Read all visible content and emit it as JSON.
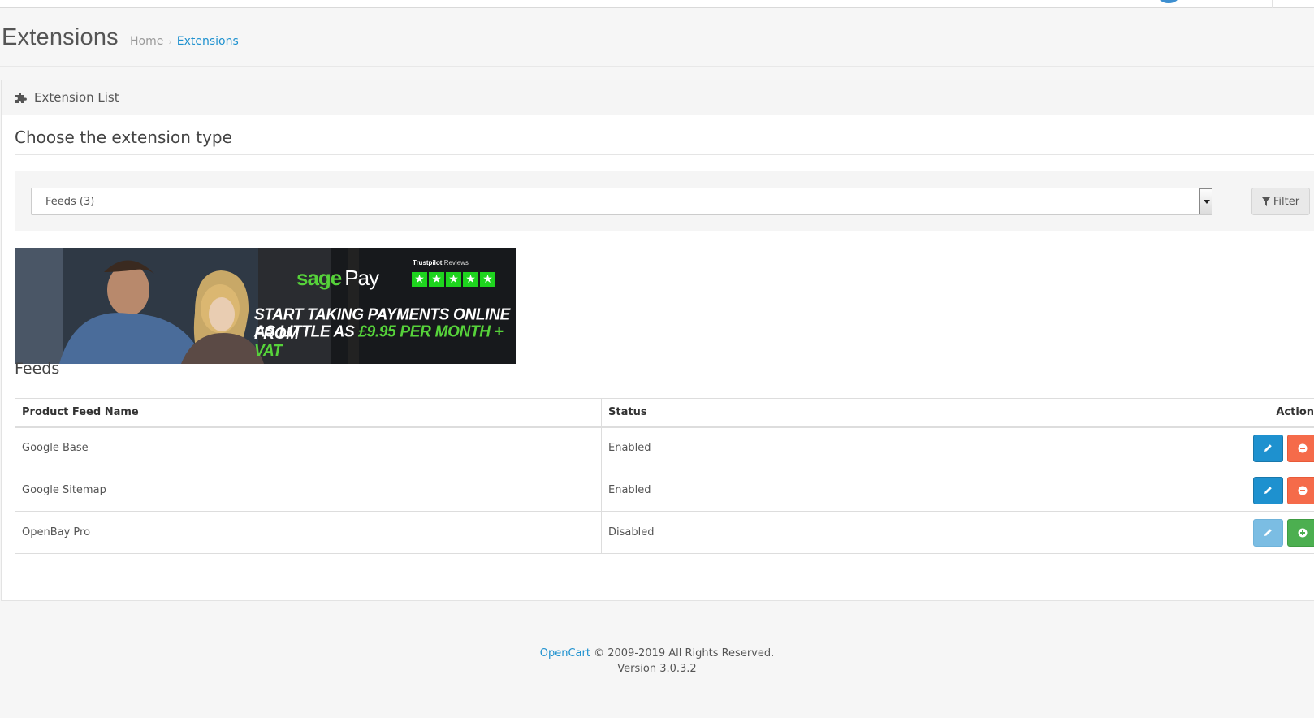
{
  "page": {
    "title": "Extensions",
    "breadcrumb": {
      "home": "Home",
      "separator": "›",
      "current": "Extensions"
    }
  },
  "panel": {
    "heading": "Extension List",
    "choose_title": "Choose the extension type",
    "select_value": "Feeds (3)",
    "filter_label": "Filter"
  },
  "banner": {
    "logo_sage": "sage",
    "logo_pay": "Pay",
    "trustpilot": "Trustpilot",
    "trustpilot_reviews": "Reviews",
    "star": "★",
    "line1": "START TAKING PAYMENTS ONLINE FROM",
    "line2_prefix": "AS LITTLE AS ",
    "line2_highlight": "£9.95 PER MONTH + VAT"
  },
  "feeds": {
    "title": "Feeds",
    "columns": {
      "name": "Product Feed Name",
      "status": "Status",
      "action": "Action"
    },
    "rows": [
      {
        "name": "Google Base",
        "status": "Enabled",
        "edit_state": "active",
        "toggle": "uninstall"
      },
      {
        "name": "Google Sitemap",
        "status": "Enabled",
        "edit_state": "active",
        "toggle": "uninstall"
      },
      {
        "name": "OpenBay Pro",
        "status": "Disabled",
        "edit_state": "disabled",
        "toggle": "install"
      }
    ]
  },
  "footer": {
    "brand": "OpenCart",
    "copyright": " © 2009-2019 All Rights Reserved.",
    "version": "Version 3.0.3.2"
  },
  "colors": {
    "primary": "#1e91cf",
    "danger": "#f56b4a",
    "success": "#4caf50",
    "sage_green": "#56d23a"
  }
}
